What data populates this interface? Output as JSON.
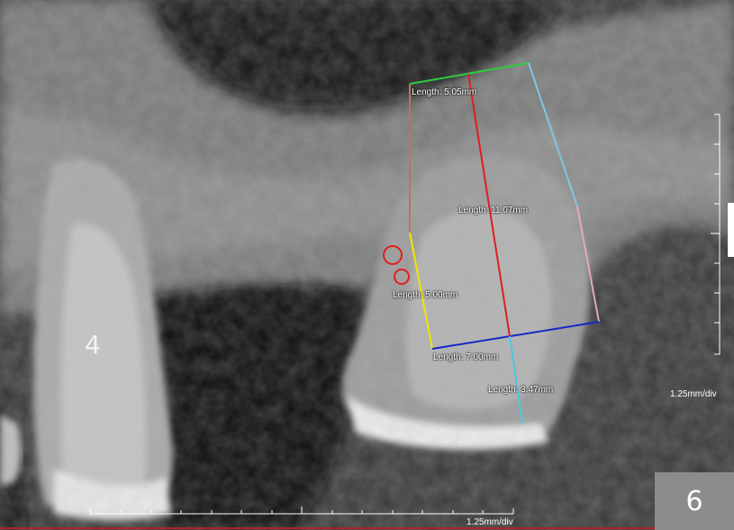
{
  "scan": {
    "tooth_number": "4",
    "figure_number": "6",
    "scale_right": "1.25mm/div",
    "scale_bottom": "1.25mm/div"
  },
  "measurements": {
    "top": "Length: 5.05mm",
    "center": "Length: 11.07mm",
    "left": "Length: 5.00mm",
    "bottom": "Length: 7.00mm",
    "lower": "Length: 3.47mm"
  },
  "colors": {
    "green": "#2ecc40",
    "blue_light": "#7fc6e6",
    "pink": "#e8a8bc",
    "brown": "#b07a5a",
    "yellow": "#f2e600",
    "red": "#e01e1e",
    "navy": "#1428c8",
    "cyan": "#4cc8e0"
  }
}
